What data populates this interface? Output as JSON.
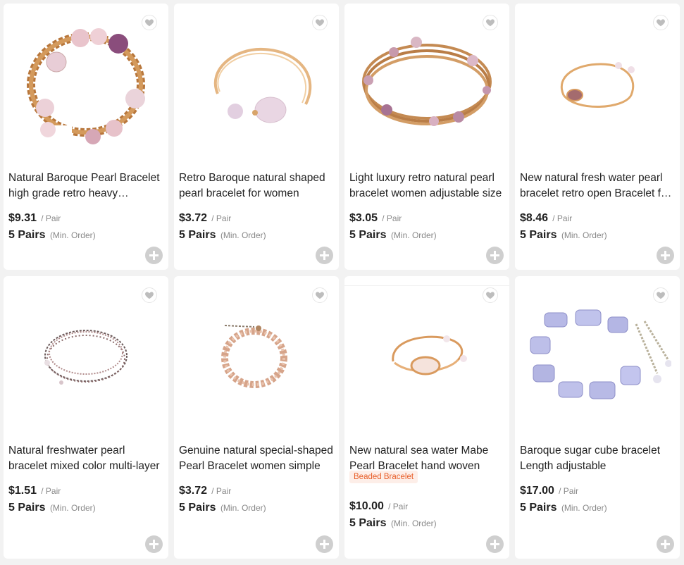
{
  "products": [
    {
      "title": "Natural Baroque Pearl Bracelet high grade retro heavy industrial style women's bracelet",
      "price": "$9.31",
      "unit": "/ Pair",
      "moq": "5 Pairs",
      "moq_note": "(Min. Order)",
      "image": "coiled-gold-wire-baroque-pearl-bracelet"
    },
    {
      "title": "Retro Baroque natural shaped pearl bracelet for women",
      "price": "$3.72",
      "unit": "/ Pair",
      "moq": "5 Pairs",
      "moq_note": "(Min. Order)",
      "image": "open-cuff-single-pearl-bracelet"
    },
    {
      "title": "Light luxury retro natural pearl bracelet women adjustable size",
      "price": "$3.05",
      "unit": "/ Pair",
      "moq": "5 Pairs",
      "moq_note": "(Min. Order)",
      "image": "multi-wrap-gold-pearl-bracelet"
    },
    {
      "title": "New natural fresh water pearl bracelet retro open Bracelet for women",
      "price": "$8.46",
      "unit": "/ Pair",
      "moq": "5 Pairs",
      "moq_note": "(Min. Order)",
      "image": "thin-open-pearl-bracelet"
    },
    {
      "title": "Natural freshwater pearl bracelet mixed color multi-layer",
      "price": "$1.51",
      "unit": "/ Pair",
      "moq": "5 Pairs",
      "moq_note": "(Min. Order)",
      "image": "multi-layer-seed-pearl-bracelet"
    },
    {
      "title": "Genuine natural special-shaped Pearl Bracelet women simple",
      "price": "$3.72",
      "unit": "/ Pair",
      "moq": "5 Pairs",
      "moq_note": "(Min. Order)",
      "image": "beaded-pink-pearl-chain-bracelet"
    },
    {
      "title": "New natural sea water Mabe Pearl Bracelet hand woven",
      "price": "$10.00",
      "unit": "/ Pair",
      "moq": "5 Pairs",
      "moq_note": "(Min. Order)",
      "tag": "Beaded Bracelet",
      "image": "mabe-pearl-woven-cuff"
    },
    {
      "title": "Baroque sugar cube bracelet Length adjustable",
      "price": "$17.00",
      "unit": "/ Pair",
      "moq": "5 Pairs",
      "moq_note": "(Min. Order)",
      "image": "sugar-cube-baroque-pearl-bracelet"
    }
  ],
  "icons": {
    "favorite": "heart-icon",
    "add": "plus-icon"
  },
  "colors": {
    "tag_bg": "#fdeee8",
    "tag_text": "#e8602b",
    "add_button": "#cfcfcf",
    "page_bg": "#f2f2f2"
  }
}
